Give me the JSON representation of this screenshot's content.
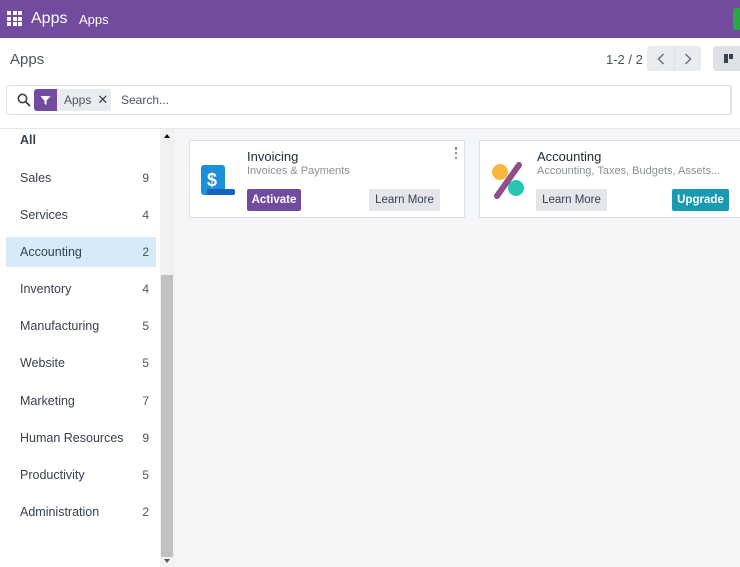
{
  "navbar": {
    "brand": "Apps",
    "menu_item": "Apps"
  },
  "control_panel": {
    "breadcrumb": "Apps",
    "pager_value": "1-2 / 2"
  },
  "search": {
    "facet_label": "Apps",
    "facet_remove": "✕",
    "placeholder": "Search...",
    "value": ""
  },
  "sidebar": {
    "items": [
      {
        "label": "All",
        "count": ""
      },
      {
        "label": "Sales",
        "count": "9"
      },
      {
        "label": "Services",
        "count": "4"
      },
      {
        "label": "Accounting",
        "count": "2"
      },
      {
        "label": "Inventory",
        "count": "4"
      },
      {
        "label": "Manufacturing",
        "count": "5"
      },
      {
        "label": "Website",
        "count": "5"
      },
      {
        "label": "Marketing",
        "count": "7"
      },
      {
        "label": "Human Resources",
        "count": "9"
      },
      {
        "label": "Productivity",
        "count": "5"
      },
      {
        "label": "Administration",
        "count": "2"
      }
    ],
    "active": "Accounting"
  },
  "cards": [
    {
      "title": "Invoicing",
      "summary": "Invoices & Payments",
      "primary_label": "Activate",
      "secondary_label": "Learn More",
      "icon": "invoicing-icon"
    },
    {
      "title": "Accounting",
      "summary": "Accounting, Taxes, Budgets, Assets...",
      "primary_label": "Upgrade",
      "secondary_label": "Learn More",
      "icon": "accounting-icon"
    }
  ],
  "colors": {
    "navbar": "#714b9d",
    "primary_button": "#714b9d",
    "upgrade_button": "#1a9ab0",
    "active_sidebar": "#d6ebf7",
    "content_bg": "#f5f6f7"
  }
}
